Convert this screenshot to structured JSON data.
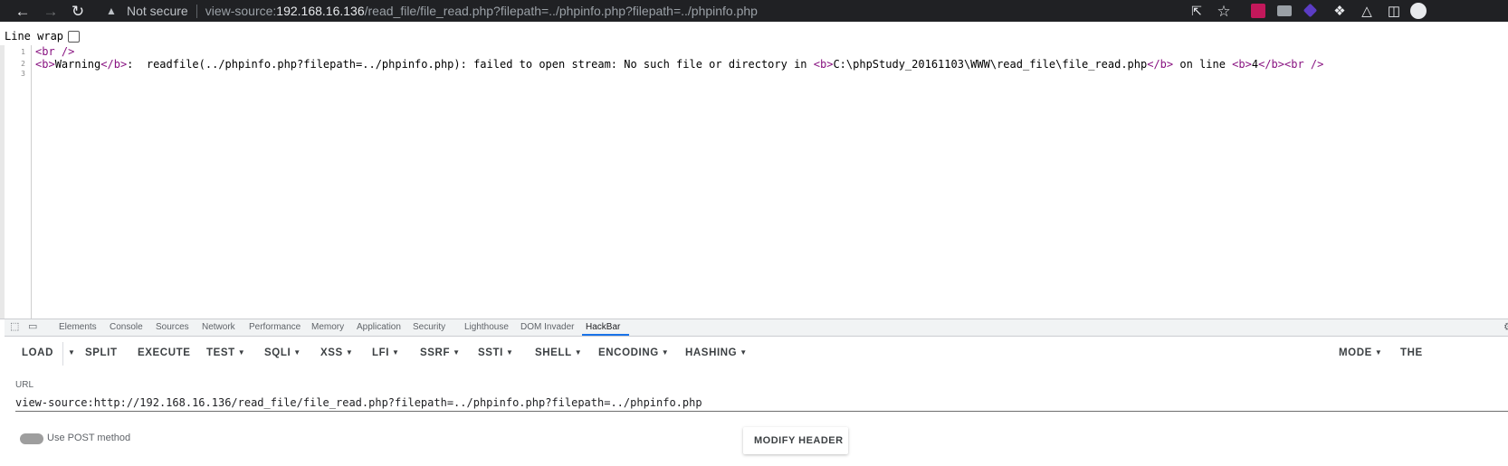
{
  "browser": {
    "security_label": "Not secure",
    "url_scheme": "view-source:",
    "url_host": "192.168.16.136",
    "url_path": "/read_file/file_read.php?filepath=../phpinfo.php?filepath=../phpinfo.php",
    "icons": [
      "back-arrow-icon",
      "forward-arrow-icon",
      "reload-icon",
      "warning-icon",
      "share-icon",
      "star-icon",
      "puzzle-icon",
      "flask-icon",
      "side-panel-icon"
    ]
  },
  "viewer": {
    "line_wrap_label": "Line wrap",
    "line_numbers": [
      "1",
      "2",
      "3"
    ],
    "line1": "<br />",
    "line2": {
      "b_open": "<b>",
      "warning": "Warning",
      "b_close": "</b>",
      "message": ":  readfile(../phpinfo.php?filepath=../phpinfo.php): failed to open stream: No such file or directory in ",
      "b_open2": "<b>",
      "path": "C:\\phpStudy_20161103\\WWW\\read_file\\file_read.php",
      "b_close2": "</b>",
      "on_line": " on line ",
      "b_open3": "<b>",
      "line_no": "4",
      "b_close3": "</b>",
      "br": "<br />"
    }
  },
  "devtools": {
    "tabs": [
      "Elements",
      "Console",
      "Sources",
      "Network",
      "Performance",
      "Memory",
      "Application",
      "Security",
      "Lighthouse",
      "DOM Invader",
      "HackBar"
    ],
    "active_tab": "HackBar"
  },
  "hackbar": {
    "buttons": {
      "load": "LOAD",
      "split": "SPLIT",
      "execute": "EXECUTE",
      "test": "TEST",
      "sqli": "SQLI",
      "xss": "XSS",
      "lfi": "LFI",
      "ssrf": "SSRF",
      "ssti": "SSTI",
      "shell": "SHELL",
      "encoding": "ENCODING",
      "hashing": "HASHING",
      "mode": "MODE",
      "theme": "THE"
    },
    "url_label": "URL",
    "url_value": "view-source:http://192.168.16.136/read_file/file_read.php?filepath=../phpinfo.php?filepath=../phpinfo.php",
    "post_label": "Use POST method",
    "modify_header_label": "MODIFY HEADER"
  },
  "colors": {
    "toolbar_bg": "#202124",
    "tag_color": "#881280",
    "accent": "#1a73e8"
  }
}
